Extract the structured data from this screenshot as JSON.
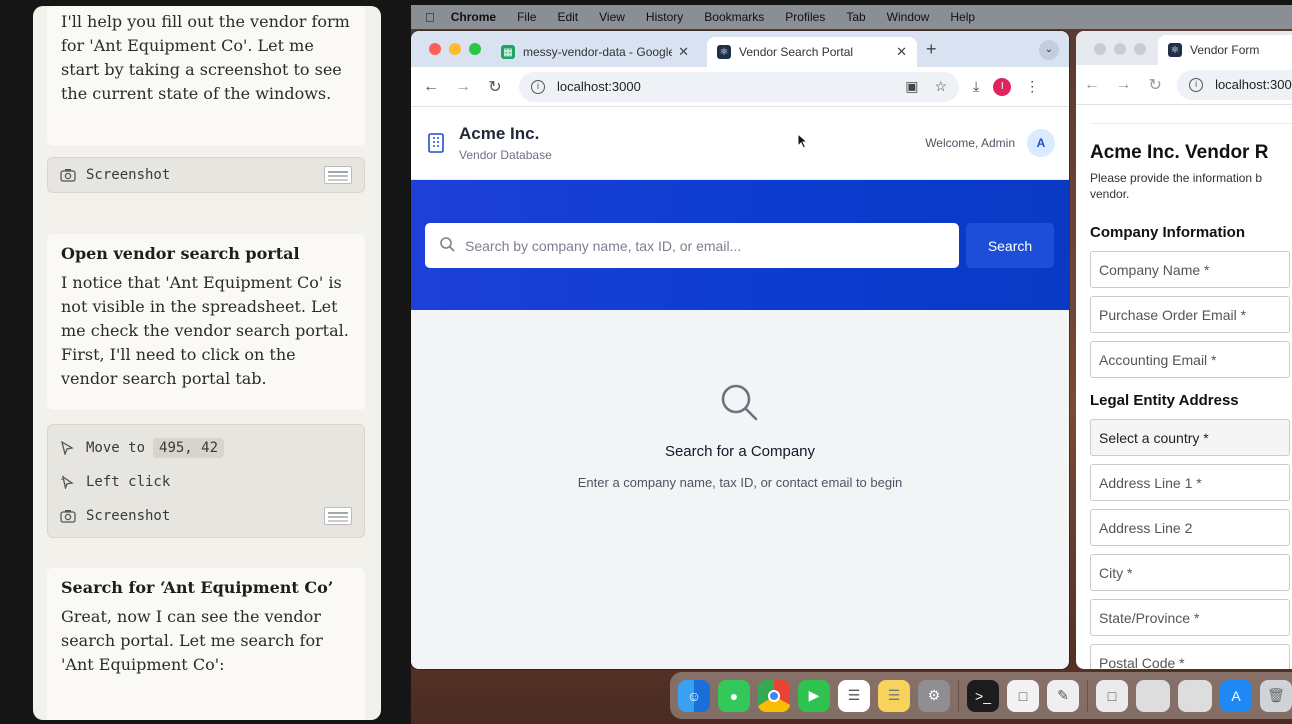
{
  "chat": {
    "msg1": "I'll help you fill out the vendor form for 'Ant Equipment Co'. Let me start by taking a screenshot to see the current state of the windows.",
    "tool1": "Screenshot",
    "step2_title": "Open vendor search portal",
    "msg2": "I notice that 'Ant Equipment Co' is not visible in the spreadsheet. Let me check the vendor search portal. First, I'll need to click on the vendor search portal tab.",
    "move_label": "Move to",
    "move_coords": "495, 42",
    "click_label": "Left click",
    "tool2": "Screenshot",
    "step3_title": "Search for ‘Ant Equipment Co’",
    "msg3": "Great, now I can see the vendor search portal. Let me search for 'Ant Equipment Co':"
  },
  "menubar": {
    "app": "Chrome",
    "items": [
      "File",
      "Edit",
      "View",
      "History",
      "Bookmarks",
      "Profiles",
      "Tab",
      "Window",
      "Help"
    ]
  },
  "browser": {
    "tab1": "messy-vendor-data - Google",
    "tab2": "Vendor Search Portal",
    "url": "localhost:3000",
    "profile_initial": "I"
  },
  "app": {
    "brand": "Acme Inc.",
    "subtitle": "Vendor Database",
    "welcome": "Welcome, Admin",
    "avatar": "A",
    "search_placeholder": "Search by company name, tax ID, or email...",
    "search_button": "Search",
    "empty_title": "Search for a Company",
    "empty_desc": "Enter a company name, tax ID, or contact email to begin"
  },
  "window2": {
    "tab": "Vendor Form",
    "url": "localhost:300",
    "title": "Acme Inc. Vendor R",
    "desc": "Please provide the information b vendor.",
    "section1": "Company Information",
    "f_company": "Company Name *",
    "f_po_email": "Purchase Order Email *",
    "f_acct_email": "Accounting Email *",
    "section2": "Legal Entity Address",
    "f_country": "Select a country *",
    "f_addr1": "Address Line 1 *",
    "f_addr2": "Address Line 2",
    "f_city": "City *",
    "f_state": "State/Province *",
    "f_postal": "Postal Code *"
  },
  "colors": {
    "accent": "#1d4ed8",
    "hero": "#0b3ccf",
    "chat_bg": "#f3f1ec"
  }
}
